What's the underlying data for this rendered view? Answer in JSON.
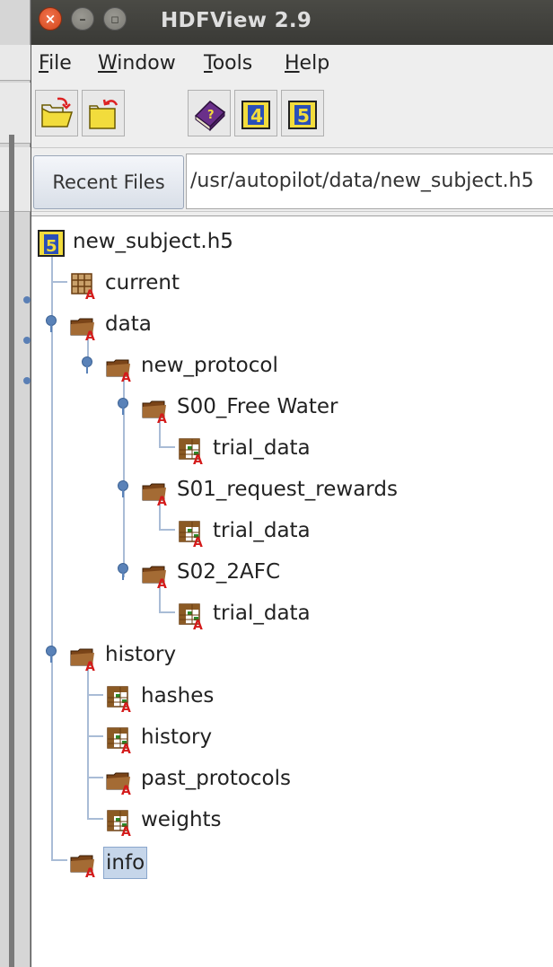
{
  "window": {
    "title": "HDFView 2.9",
    "close_glyph": "×",
    "minimize_glyph": "–",
    "maximize_glyph": "▫"
  },
  "menubar": {
    "items": [
      {
        "mnemonic": "F",
        "rest": "ile"
      },
      {
        "mnemonic": "W",
        "rest": "indow"
      },
      {
        "mnemonic": "T",
        "rest": "ools"
      },
      {
        "mnemonic": "H",
        "rest": "elp"
      }
    ]
  },
  "toolbar": {
    "buttons": [
      {
        "icon": "open-folder-icon"
      },
      {
        "icon": "open-folder-readonly-icon"
      },
      {
        "icon": "users-guide-book-icon"
      },
      {
        "icon": "hdf4-library-version-icon",
        "text": "4"
      },
      {
        "icon": "hdf5-library-version-icon",
        "text": "5"
      }
    ]
  },
  "recent": {
    "button_label": "Recent Files",
    "path_value": "/usr/autopilot/data/new_subject.h5"
  },
  "tree": {
    "root": "new_subject.h5",
    "root_badge": "5",
    "nodes": [
      {
        "label": "current",
        "icon": "compound-dataset-icon"
      },
      {
        "label": "data",
        "icon": "group-folder-icon"
      },
      {
        "label": "new_protocol",
        "icon": "group-folder-icon"
      },
      {
        "label": "S00_Free Water",
        "icon": "group-folder-icon"
      },
      {
        "label": "trial_data",
        "icon": "table-dataset-icon"
      },
      {
        "label": "S01_request_rewards",
        "icon": "group-folder-icon"
      },
      {
        "label": "trial_data",
        "icon": "table-dataset-icon"
      },
      {
        "label": "S02_2AFC",
        "icon": "group-folder-icon"
      },
      {
        "label": "trial_data",
        "icon": "table-dataset-icon"
      },
      {
        "label": "history",
        "icon": "group-folder-icon"
      },
      {
        "label": "hashes",
        "icon": "table-dataset-icon"
      },
      {
        "label": "history",
        "icon": "table-dataset-icon"
      },
      {
        "label": "past_protocols",
        "icon": "group-folder-icon"
      },
      {
        "label": "weights",
        "icon": "table-dataset-icon"
      },
      {
        "label": "info",
        "icon": "group-folder-icon",
        "selected": true
      }
    ]
  },
  "colors": {
    "accent_selection": "#c6d6ea",
    "tree_line": "#a9bcd6",
    "titlebar": "#3c3b37",
    "close_button": "#e05a2b"
  }
}
